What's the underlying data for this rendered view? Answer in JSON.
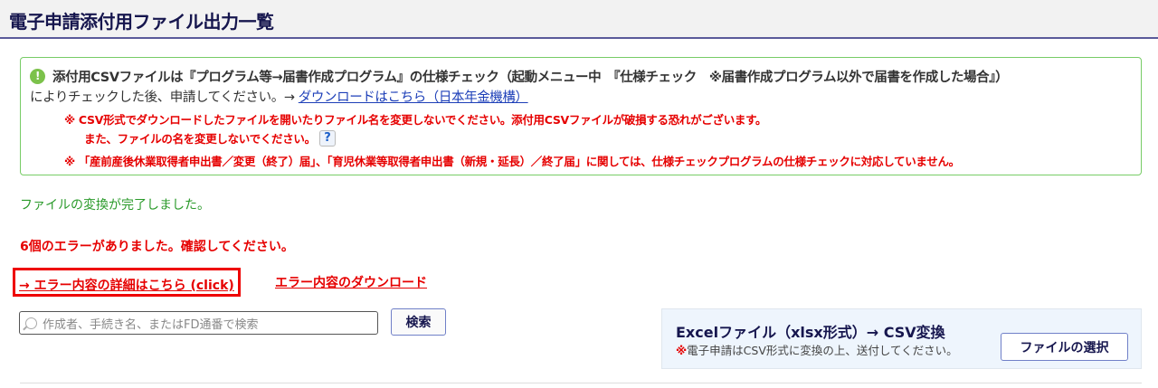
{
  "header": {
    "title": "電子申請添付用ファイル出力一覧"
  },
  "notice": {
    "line1": "添付用CSVファイルは『プログラム等→届書作成プログラム』の仕様チェック（起動メニュー中　『仕様チェック　※届書作成プログラム以外で届書を作成した場合』）",
    "line2": "によりチェックした後、申請してください。→ ",
    "download_link": "ダウンロードはこちら（日本年金機構）",
    "warning1": "※  CSV形式でダウンロードしたファイルを開いたりファイル名を変更しないでください。添付用CSVファイルが破損する恐れがございます。",
    "warning1b": "また、ファイルの名を変更しないでください。",
    "help": "?",
    "warning2": "※  「産前産後休業取得者申出書／変更（終了）届」、「育児休業等取得者申出書（新規・延長）／終了届」に関しては、仕様チェックプログラムの仕様チェックに対応していません。",
    "icon": "!"
  },
  "status": {
    "done": "ファイルの変換が完了しました。",
    "errors": "6個のエラーがありました。確認してください。"
  },
  "links": {
    "error_detail": "→ エラー内容の詳細はこちら (click)",
    "error_download": "エラー内容のダウンロード"
  },
  "search": {
    "placeholder": "作成者、手続き名、またはFD通番で検索",
    "button": "検索"
  },
  "excel": {
    "title": "Excelファイル（xlsx形式）→ CSV変換",
    "mark": "※",
    "note": "電子申請はCSV形式に変換の上、送付してください。",
    "button": "ファイルの選択"
  }
}
